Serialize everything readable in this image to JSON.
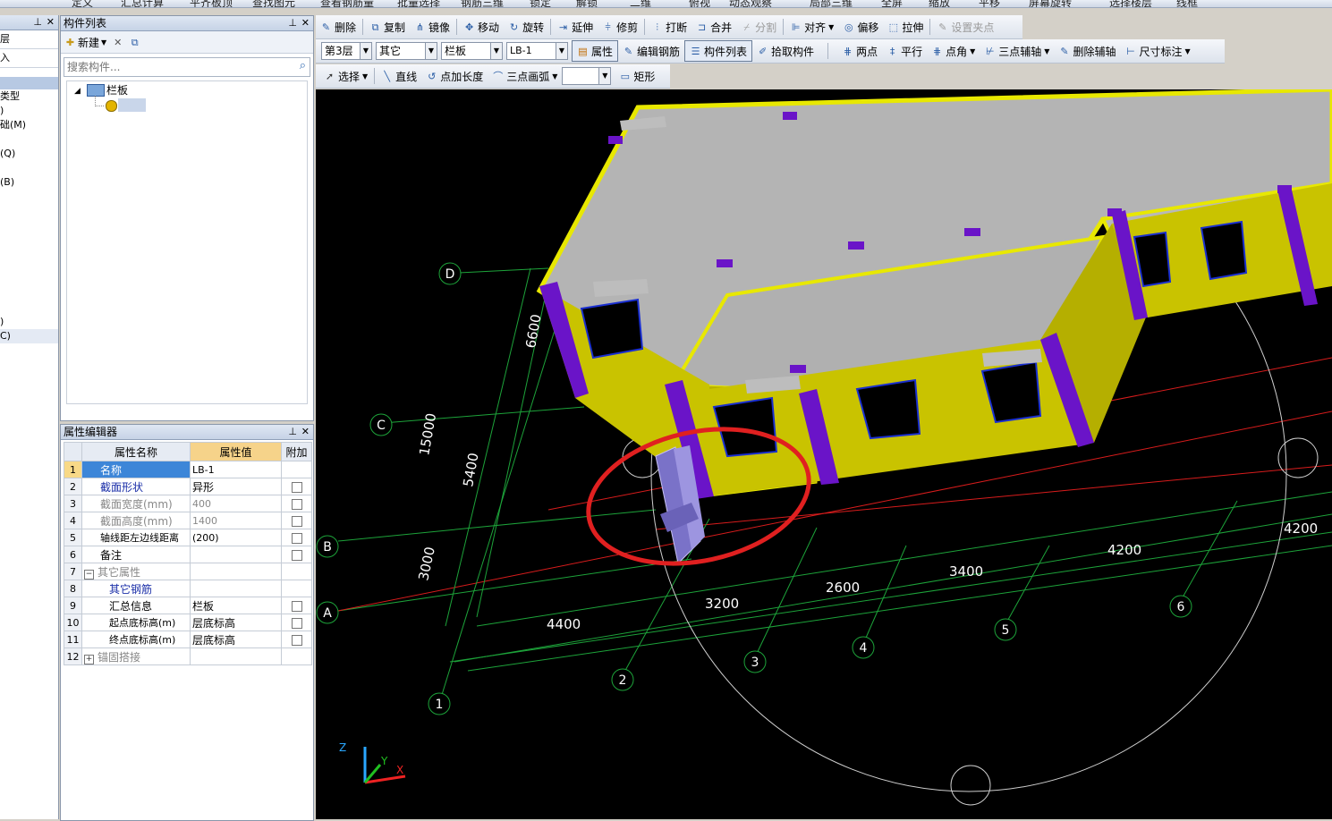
{
  "top_strip": [
    "定义",
    "汇总计算",
    "平齐板顶",
    "查找图元",
    "查看钢筋量",
    "批量选择",
    "钢筋三维",
    "锁定",
    "解锁",
    "二维",
    "俯视",
    "动态观察",
    "局部三维",
    "全屏",
    "缩放",
    "平移",
    "屏幕旋转",
    "选择楼层",
    "线框"
  ],
  "left_panel": {
    "items": [
      "层",
      "入",
      "类型",
      ")",
      "础(M)",
      "(Q)",
      "(B)",
      ")",
      "C)"
    ]
  },
  "component_list": {
    "title": "构件列表",
    "new_label": "新建",
    "search_placeholder": "搜索构件...",
    "tree_root": "栏板",
    "tree_child": "LB-1"
  },
  "property_editor": {
    "title": "属性编辑器",
    "headers": [
      "属性名称",
      "属性值",
      "附加"
    ],
    "rows": [
      {
        "n": "1",
        "name": "名称",
        "value": "LB-1"
      },
      {
        "n": "2",
        "name": "截面形状",
        "value": "异形"
      },
      {
        "n": "3",
        "name": "截面宽度(mm)",
        "value": "400"
      },
      {
        "n": "4",
        "name": "截面高度(mm)",
        "value": "1400"
      },
      {
        "n": "5",
        "name": "轴线距左边线距离",
        "value": "(200)"
      },
      {
        "n": "6",
        "name": "备注",
        "value": ""
      },
      {
        "n": "7",
        "name": "其它属性",
        "value": ""
      },
      {
        "n": "8",
        "name": "其它钢筋",
        "value": ""
      },
      {
        "n": "9",
        "name": "汇总信息",
        "value": "栏板"
      },
      {
        "n": "10",
        "name": "起点底标高(m)",
        "value": "层底标高"
      },
      {
        "n": "11",
        "name": "终点底标高(m)",
        "value": "层底标高"
      },
      {
        "n": "12",
        "name": "锚固搭接",
        "value": ""
      }
    ]
  },
  "toolbar1": [
    "删除",
    "复制",
    "镜像",
    "移动",
    "旋转",
    "延伸",
    "修剪",
    "打断",
    "合并",
    "分割",
    "对齐",
    "偏移",
    "拉伸",
    "设置夹点"
  ],
  "toolbar2": {
    "floor": "第3层",
    "type": "其它",
    "component": "栏板",
    "name": "LB-1",
    "buttons": [
      "属性",
      "编辑钢筋",
      "构件列表",
      "拾取构件",
      "两点",
      "平行",
      "点角",
      "三点辅轴",
      "删除辅轴",
      "尺寸标注"
    ]
  },
  "toolbar3": [
    "选择",
    "直线",
    "点加长度",
    "三点画弧",
    "矩形"
  ],
  "viewport": {
    "axis_labels_letters": [
      "A",
      "B",
      "C",
      "D"
    ],
    "axis_labels_numbers": [
      "1",
      "2",
      "3",
      "4",
      "5",
      "6"
    ],
    "dims_left": [
      "3000",
      "5400",
      "6600",
      "15000"
    ],
    "dims_bottom": [
      "4400",
      "3200",
      "2600",
      "3400",
      "4200",
      "4200"
    ],
    "axes_triad": [
      "Z",
      "Y",
      "X"
    ]
  }
}
